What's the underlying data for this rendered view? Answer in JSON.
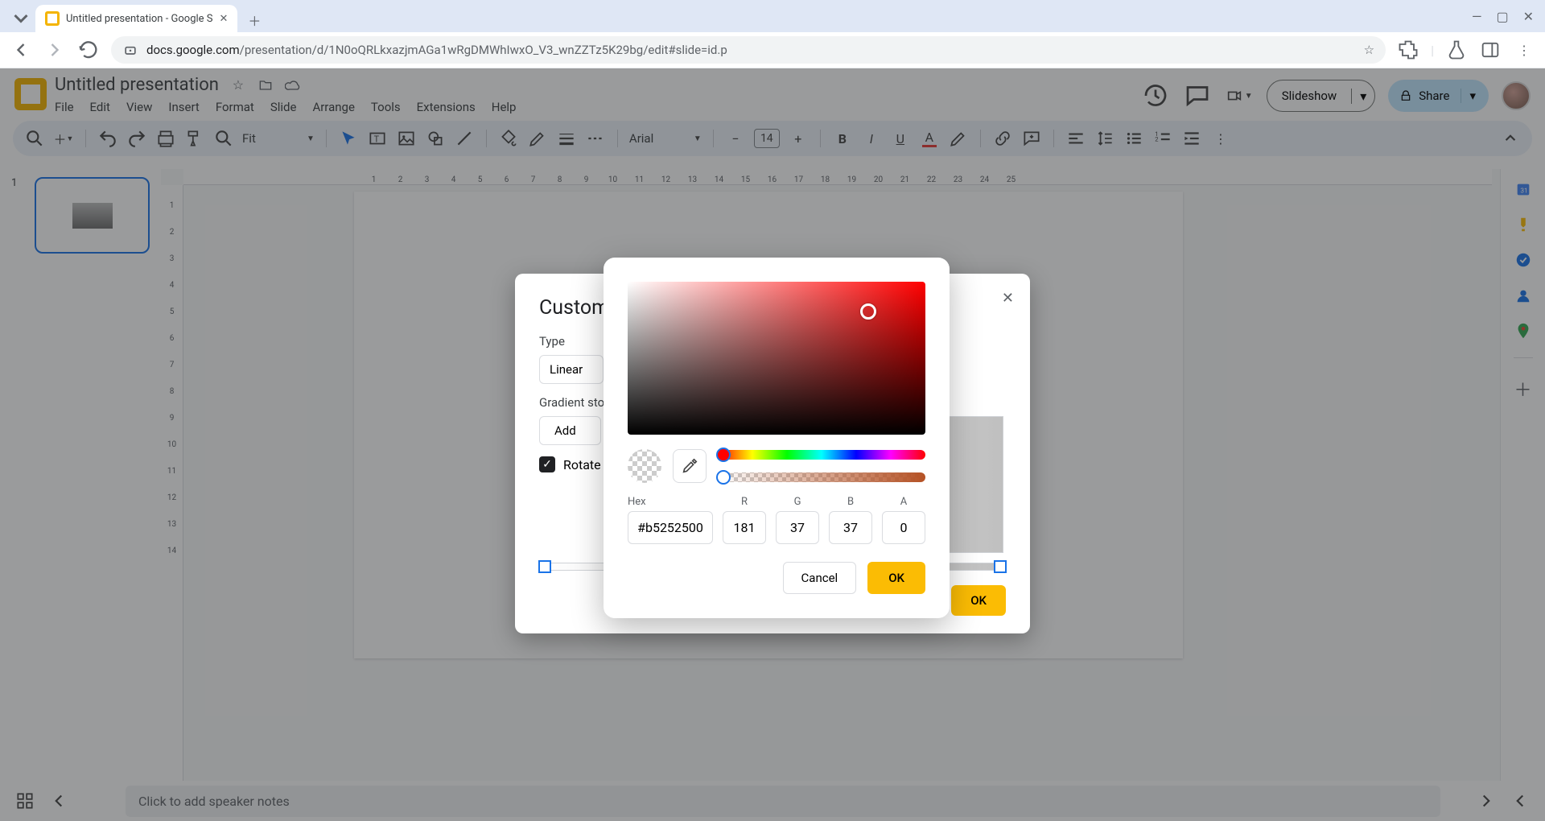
{
  "browser": {
    "tab_title": "Untitled presentation - Google S",
    "url_host": "docs.google.com",
    "url_path": "/presentation/d/1N0oQRLkxazjmAGa1wRgDMWhIwxO_V3_wnZZTz5K29bg/edit#slide=id.p"
  },
  "header": {
    "doc_title": "Untitled presentation",
    "menus": [
      "File",
      "Edit",
      "View",
      "Insert",
      "Format",
      "Slide",
      "Arrange",
      "Tools",
      "Extensions",
      "Help"
    ],
    "slideshow_label": "Slideshow",
    "share_label": "Share"
  },
  "toolbar": {
    "zoom_label": "Fit",
    "font_name": "Arial",
    "font_size": "14"
  },
  "slides": {
    "current_number": "1"
  },
  "ruler": {
    "h": [
      "1",
      "2",
      "3",
      "4",
      "5",
      "6",
      "7",
      "8",
      "9",
      "10",
      "11",
      "12",
      "13",
      "14",
      "15",
      "16",
      "17",
      "18",
      "19",
      "20",
      "21",
      "22",
      "23",
      "24",
      "25"
    ],
    "v": [
      "1",
      "2",
      "3",
      "4",
      "5",
      "6",
      "7",
      "8",
      "9",
      "10",
      "11",
      "12",
      "13",
      "14"
    ]
  },
  "notes_placeholder": "Click to add speaker notes",
  "gradient_dialog": {
    "title": "Custom gradient",
    "type_label": "Type",
    "type_value": "Linear",
    "stops_label": "Gradient stops",
    "add_label": "Add",
    "rotate_label": "Rotate",
    "ok_label": "OK"
  },
  "color_picker": {
    "hex_label": "Hex",
    "r_label": "R",
    "g_label": "G",
    "b_label": "B",
    "a_label": "A",
    "hex_value": "#b5252500",
    "r_value": "181",
    "g_value": "37",
    "b_value": "37",
    "a_value": "0",
    "cancel_label": "Cancel",
    "ok_label": "OK",
    "hue_thumb_pct": 0,
    "alpha_thumb_pct": 0
  }
}
